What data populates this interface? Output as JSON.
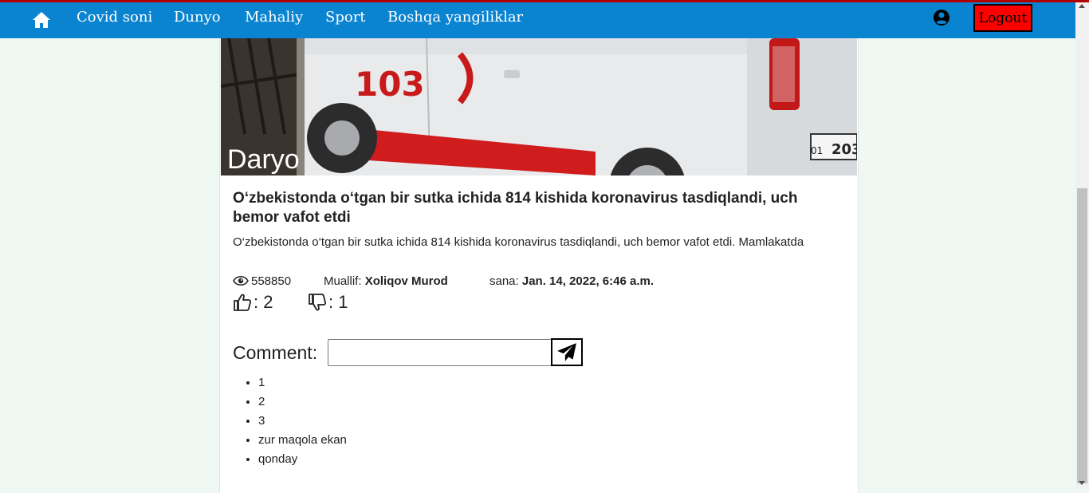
{
  "nav": {
    "links": [
      "Covid soni",
      "Dunyo",
      "Mahaliy",
      "Sport",
      "Boshqa yangiliklar"
    ],
    "logout_label": "Logout",
    "home_icon": "home-icon",
    "user_icon": "user-circle-icon"
  },
  "article": {
    "image_watermark": "Daryo",
    "image_vehicle_number": "103",
    "title": "O‘zbekistonda o‘tgan bir sutka ichida 814 kishida koronavirus tasdiqlandi, uch bemor vafot etdi",
    "excerpt": "O‘zbekistonda o‘tgan bir sutka ichida 814 kishida koronavirus tasdiqlandi, uch bemor vafot etdi. Mamlakatda",
    "views": "558850",
    "author_label": "Muallif:",
    "author": "Xoliqov Murod",
    "date_label": "sana:",
    "date": "Jan. 14, 2022, 6:46 a.m.",
    "likes": ": 2",
    "dislikes": ": 1"
  },
  "comment_form": {
    "label": "Comment:",
    "input_value": "",
    "send_icon": "paper-plane-icon"
  },
  "comments": [
    "1",
    "2",
    "3",
    "zur maqola ekan",
    "qonday"
  ],
  "colors": {
    "navbar": "#0a84d0",
    "page_background": "#eff8f3",
    "logout_background": "#ff0000"
  }
}
